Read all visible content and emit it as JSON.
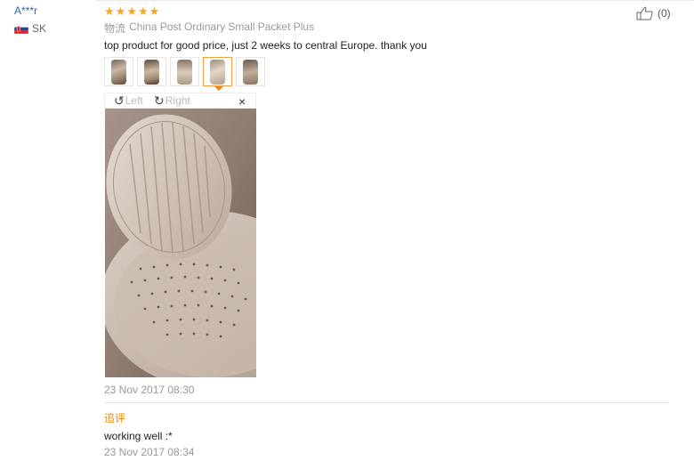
{
  "reviewer": {
    "name": "A***r",
    "country": "SK"
  },
  "review": {
    "rating": 5,
    "stars": [
      "★",
      "★",
      "★",
      "★",
      "★"
    ],
    "logistics_label": "物流",
    "logistics_value": "China Post Ordinary Small Packet Plus",
    "feedback": "top product for good price, just 2 weeks to central Europe. thank you",
    "date": "23 Nov 2017 08:30"
  },
  "helpful": {
    "count": "(0)",
    "icon": "thumbs-up-icon"
  },
  "thumbnails": {
    "count": 5,
    "active_index": 3
  },
  "viewer": {
    "left_label": "Left",
    "right_label": "Right",
    "close_label": "×"
  },
  "additional_feedback": {
    "label": "追评",
    "text": "working well :*",
    "date": "23 Nov 2017 08:34"
  },
  "colors": {
    "star": "#f5a623",
    "username": "#2b5fb3",
    "accent": "#f08a00",
    "muted": "#999999"
  }
}
